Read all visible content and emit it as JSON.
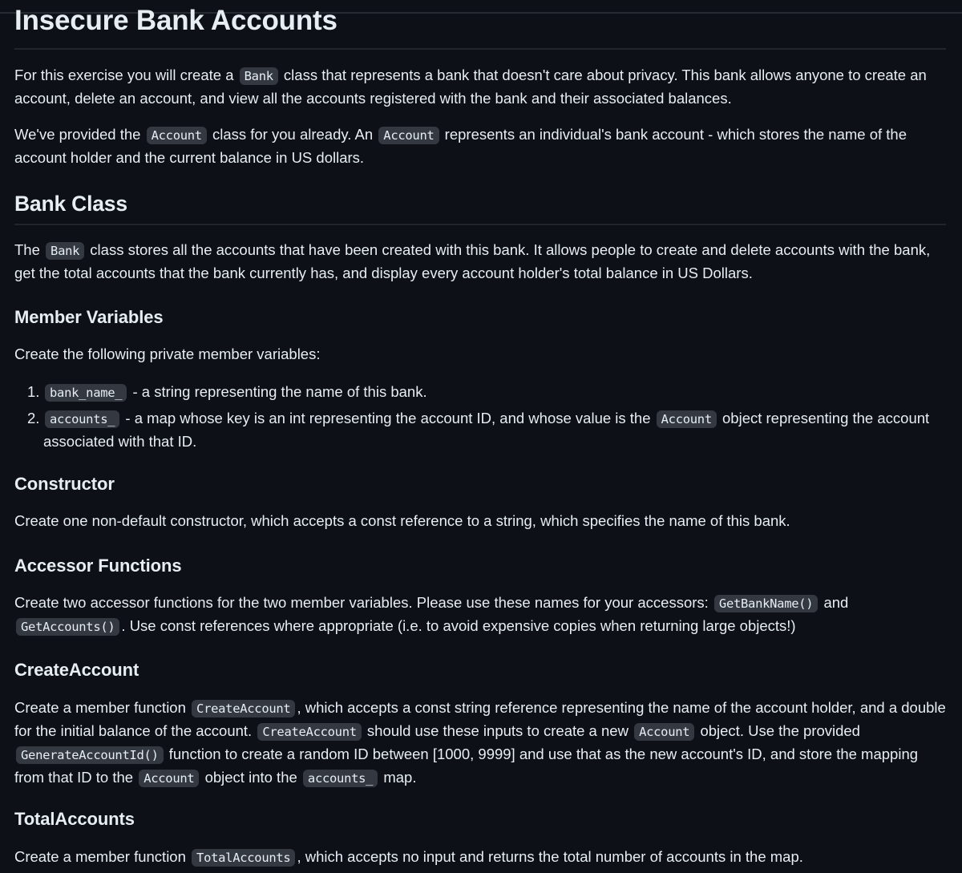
{
  "title": "Insecure Bank Accounts",
  "intro": {
    "p1": {
      "before": "For this exercise you will create a ",
      "code": "Bank",
      "after": " class that represents a bank that doesn't care about privacy. This bank allows anyone to create an account, delete an account, and view all the accounts registered with the bank and their associated balances."
    },
    "p2": {
      "t1": "We've provided the ",
      "code1": "Account",
      "t2": " class for you already. An ",
      "code2": "Account",
      "t3": " represents an individual's bank account - which stores the name of the account holder and the current balance in US dollars."
    }
  },
  "bank_class": {
    "heading": "Bank Class",
    "p": {
      "t1": "The ",
      "code1": "Bank",
      "t2": " class stores all the accounts that have been created with this bank. It allows people to create and delete accounts with the bank, get the total accounts that the bank currently has, and display every account holder's total balance in US Dollars."
    }
  },
  "member_variables": {
    "heading": "Member Variables",
    "intro": "Create the following private member variables:",
    "items": [
      {
        "num": "1.",
        "code": "bank_name_",
        "text": " - a string representing the name of this bank.",
        "code2": "",
        "text2": ""
      },
      {
        "num": "2.",
        "code": "accounts_",
        "text": " - a map whose key is an int representing the account ID, and whose value is the ",
        "code2": "Account",
        "text2": " object representing the account associated with that ID."
      }
    ]
  },
  "constructor": {
    "heading": "Constructor",
    "p": "Create one non-default constructor, which accepts a const reference to a string, which specifies the name of this bank."
  },
  "accessor_functions": {
    "heading": "Accessor Functions",
    "p": {
      "t1": "Create two accessor functions for the two member variables. Please use these names for your accessors: ",
      "code1": "GetBankName()",
      "t2": " and ",
      "code2": "GetAccounts()",
      "t3": ". Use const references where appropriate (i.e. to avoid expensive copies when returning large objects!)"
    }
  },
  "create_account": {
    "heading": "CreateAccount",
    "p": {
      "t1": "Create a member function ",
      "code1": "CreateAccount",
      "t2": ", which accepts a const string reference representing the name of the account holder, and a double for the initial balance of the account. ",
      "code2": "CreateAccount",
      "t3": " should use these inputs to create a new ",
      "code3": "Account",
      "t4": " object. Use the provided ",
      "code4": "GenerateAccountId()",
      "t5": " function to create a random ID between [1000, 9999] and use that as the new account's ID, and store the mapping from that ID to the ",
      "code5": "Account",
      "t6": " object into the ",
      "code6": "accounts_",
      "t7": " map."
    }
  },
  "total_accounts": {
    "heading": "TotalAccounts",
    "p": {
      "t1": "Create a member function ",
      "code1": "TotalAccounts",
      "t2": ", which accepts no input and returns the total number of accounts in the map."
    }
  }
}
